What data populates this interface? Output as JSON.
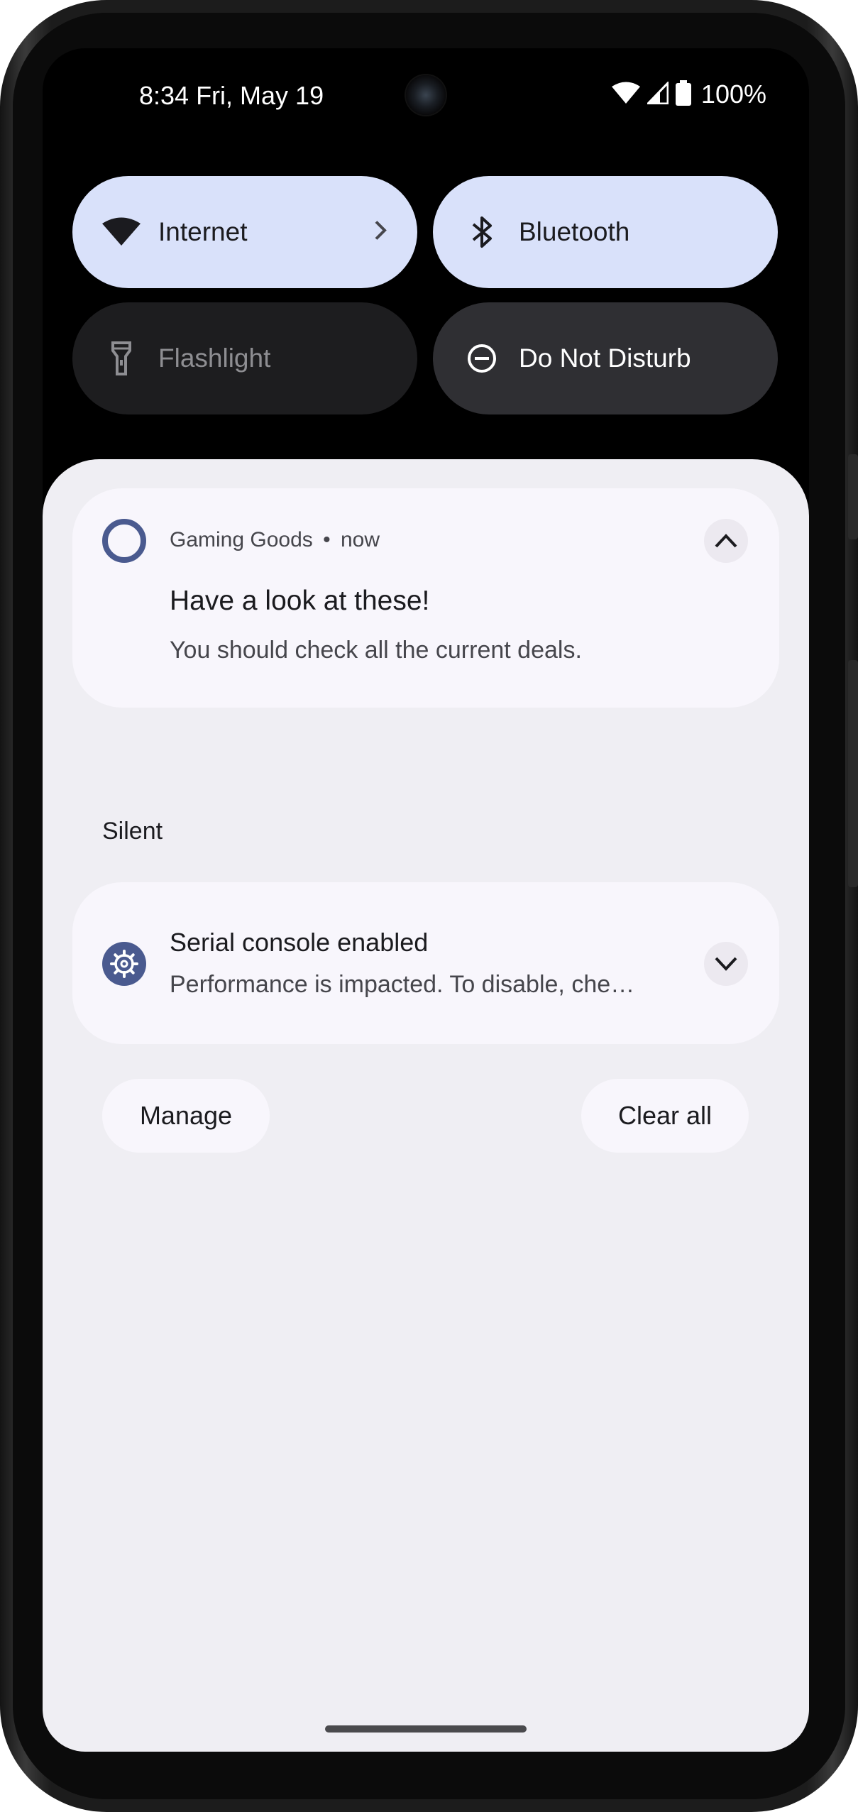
{
  "status_bar": {
    "time_date": "8:34 Fri, May 19",
    "battery_percent": "100%",
    "icons": [
      "wifi-icon",
      "cellular-icon",
      "battery-icon"
    ]
  },
  "quick_settings": {
    "tiles": [
      {
        "label": "Internet",
        "icon": "wifi-icon",
        "state": "on",
        "has_chevron": true
      },
      {
        "label": "Bluetooth",
        "icon": "bluetooth-icon",
        "state": "on"
      },
      {
        "label": "Flashlight",
        "icon": "flashlight-icon",
        "state": "off"
      },
      {
        "label": "Do Not Disturb",
        "icon": "dnd-icon",
        "state": "off"
      }
    ]
  },
  "notifications": {
    "alerting": {
      "app_name": "Gaming Goods",
      "separator": "•",
      "time": "now",
      "app_icon": "ring-icon",
      "title": "Have a look at these!",
      "text": "You should check all the current deals.",
      "expand_state": "expanded"
    },
    "silent_section_label": "Silent",
    "silent": {
      "app_icon": "gear-icon",
      "title": "Serial console enabled",
      "text": "Performance is impacted. To disable, che…",
      "expand_state": "collapsed"
    }
  },
  "footer": {
    "manage_label": "Manage",
    "clear_all_label": "Clear all"
  },
  "colors": {
    "tile_on": "#d9e1fa",
    "tile_off": "#1d1d1f",
    "tile_dnd": "#2f2f33",
    "shade_bg": "#efeef3",
    "card_bg": "#f8f6fc",
    "accent_icon": "#4a5a8f"
  }
}
